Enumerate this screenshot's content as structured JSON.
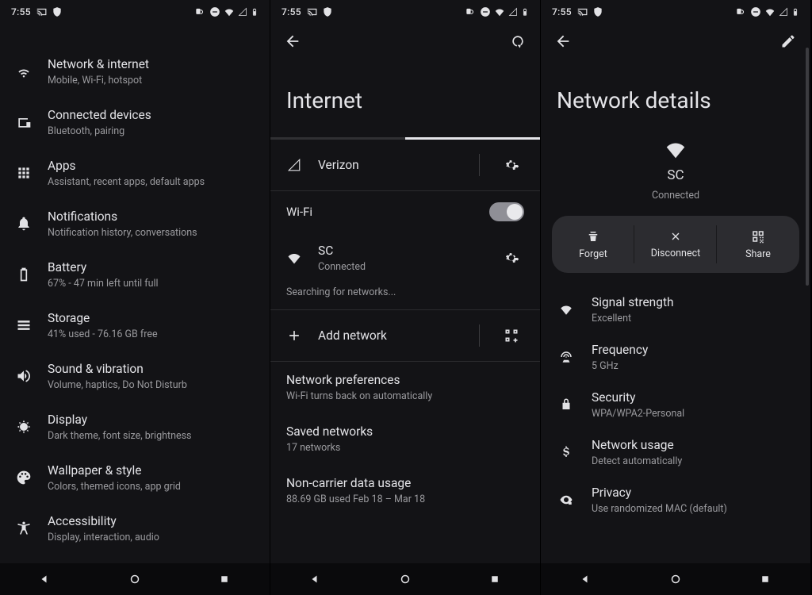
{
  "status": {
    "time": "7:55",
    "battery_pct": ""
  },
  "settings": {
    "items": [
      {
        "icon": "wifi",
        "title": "Network & internet",
        "sub": "Mobile, Wi-Fi, hotspot"
      },
      {
        "icon": "devices",
        "title": "Connected devices",
        "sub": "Bluetooth, pairing"
      },
      {
        "icon": "apps",
        "title": "Apps",
        "sub": "Assistant, recent apps, default apps"
      },
      {
        "icon": "bell",
        "title": "Notifications",
        "sub": "Notification history, conversations"
      },
      {
        "icon": "battery",
        "title": "Battery",
        "sub": "67% - 47 min left until full"
      },
      {
        "icon": "storage",
        "title": "Storage",
        "sub": "41% used - 76.16 GB free"
      },
      {
        "icon": "sound",
        "title": "Sound & vibration",
        "sub": "Volume, haptics, Do Not Disturb"
      },
      {
        "icon": "display",
        "title": "Display",
        "sub": "Dark theme, font size, brightness"
      },
      {
        "icon": "palette",
        "title": "Wallpaper & style",
        "sub": "Colors, themed icons, app grid"
      },
      {
        "icon": "accessibility",
        "title": "Accessibility",
        "sub": "Display, interaction, audio"
      }
    ]
  },
  "internet": {
    "title": "Internet",
    "carrier": {
      "name": "Verizon"
    },
    "wifi_label": "Wi-Fi",
    "wifi_on": true,
    "current": {
      "ssid": "SC",
      "status": "Connected"
    },
    "searching": "Searching for networks...",
    "add_network": "Add network",
    "prefs": [
      {
        "title": "Network preferences",
        "sub": "Wi-Fi turns back on automatically"
      },
      {
        "title": "Saved networks",
        "sub": "17 networks"
      },
      {
        "title": "Non-carrier data usage",
        "sub": "88.69 GB used Feb 18 – Mar 18"
      }
    ]
  },
  "details": {
    "title": "Network details",
    "ssid": "SC",
    "status": "Connected",
    "actions": {
      "forget": "Forget",
      "disconnect": "Disconnect",
      "share": "Share"
    },
    "rows": [
      {
        "icon": "wifi-full",
        "title": "Signal strength",
        "sub": "Excellent"
      },
      {
        "icon": "freq",
        "title": "Frequency",
        "sub": "5 GHz"
      },
      {
        "icon": "lock",
        "title": "Security",
        "sub": "WPA/WPA2-Personal"
      },
      {
        "icon": "dollar",
        "title": "Network usage",
        "sub": "Detect automatically"
      },
      {
        "icon": "eye-lock",
        "title": "Privacy",
        "sub": "Use randomized MAC (default)"
      }
    ]
  }
}
